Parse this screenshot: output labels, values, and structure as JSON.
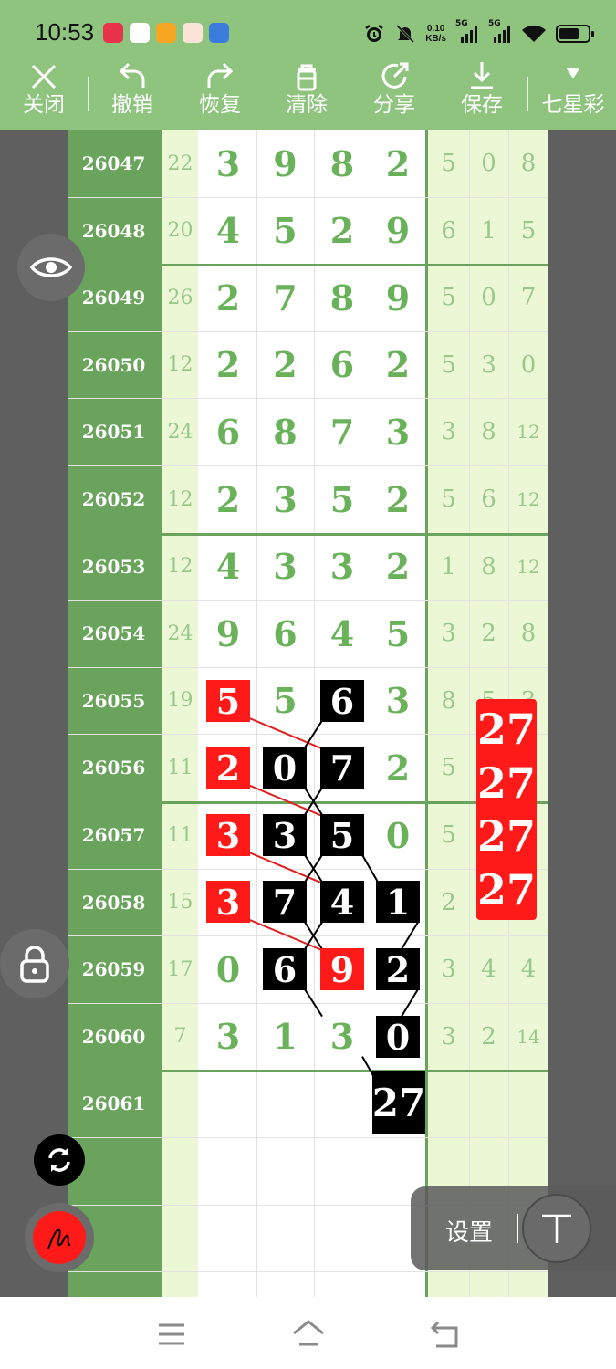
{
  "status_bar": {
    "time": "10:53",
    "net_speed_value": "0.10",
    "net_speed_unit": "KB/s",
    "signal_1": "5G",
    "signal_2": "5G",
    "icons": [
      "alarm-icon",
      "mute-icon",
      "signal-icon",
      "signal-icon",
      "wifi-icon",
      "battery-icon"
    ]
  },
  "toolbar": {
    "close": "关闭",
    "undo": "撤销",
    "redo": "恢复",
    "clear": "清除",
    "share": "分享",
    "save": "保存",
    "lottery": "七星彩"
  },
  "table": {
    "rows": [
      {
        "period": "26047",
        "sum": "22",
        "digits": [
          "3",
          "9",
          "8",
          "2"
        ],
        "extra": [
          "5",
          "0",
          "8"
        ]
      },
      {
        "period": "26048",
        "sum": "20",
        "digits": [
          "4",
          "5",
          "2",
          "9"
        ],
        "extra": [
          "6",
          "1",
          "5"
        ]
      },
      {
        "period": "26049",
        "sum": "26",
        "digits": [
          "2",
          "7",
          "8",
          "9"
        ],
        "extra": [
          "5",
          "0",
          "7"
        ]
      },
      {
        "period": "26050",
        "sum": "12",
        "digits": [
          "2",
          "2",
          "6",
          "2"
        ],
        "extra": [
          "5",
          "3",
          "0"
        ]
      },
      {
        "period": "26051",
        "sum": "24",
        "digits": [
          "6",
          "8",
          "7",
          "3"
        ],
        "extra": [
          "3",
          "8",
          "12"
        ]
      },
      {
        "period": "26052",
        "sum": "12",
        "digits": [
          "2",
          "3",
          "5",
          "2"
        ],
        "extra": [
          "5",
          "6",
          "12"
        ]
      },
      {
        "period": "26053",
        "sum": "12",
        "digits": [
          "4",
          "3",
          "3",
          "2"
        ],
        "extra": [
          "1",
          "8",
          "12"
        ]
      },
      {
        "period": "26054",
        "sum": "24",
        "digits": [
          "9",
          "6",
          "4",
          "5"
        ],
        "extra": [
          "3",
          "2",
          "8"
        ]
      },
      {
        "period": "26055",
        "sum": "19",
        "digits": [
          "5",
          "5",
          "6",
          "3"
        ],
        "extra": [
          "8",
          "5",
          "3"
        ]
      },
      {
        "period": "26056",
        "sum": "11",
        "digits": [
          "2",
          "0",
          "7",
          "2"
        ],
        "extra": [
          "5",
          "",
          ""
        ]
      },
      {
        "period": "26057",
        "sum": "11",
        "digits": [
          "3",
          "3",
          "5",
          "0"
        ],
        "extra": [
          "5",
          "",
          ""
        ]
      },
      {
        "period": "26058",
        "sum": "15",
        "digits": [
          "3",
          "7",
          "4",
          "1"
        ],
        "extra": [
          "2",
          "",
          ""
        ]
      },
      {
        "period": "26059",
        "sum": "17",
        "digits": [
          "0",
          "6",
          "9",
          "2"
        ],
        "extra": [
          "3",
          "4",
          "4"
        ]
      },
      {
        "period": "26060",
        "sum": "7",
        "digits": [
          "3",
          "1",
          "3",
          "0"
        ],
        "extra": [
          "3",
          "2",
          "14"
        ]
      },
      {
        "period": "26061",
        "sum": "",
        "digits": [
          "",
          "",
          "",
          ""
        ],
        "extra": [
          "",
          "",
          ""
        ]
      }
    ],
    "marks": [
      {
        "row": 8,
        "col": 0,
        "color": "red",
        "text": "5"
      },
      {
        "row": 8,
        "col": 2,
        "color": "black",
        "text": "6"
      },
      {
        "row": 9,
        "col": 0,
        "color": "red",
        "text": "2"
      },
      {
        "row": 9,
        "col": 1,
        "color": "black",
        "text": "0"
      },
      {
        "row": 9,
        "col": 2,
        "color": "black",
        "text": "7"
      },
      {
        "row": 10,
        "col": 0,
        "color": "red",
        "text": "3"
      },
      {
        "row": 10,
        "col": 1,
        "color": "black",
        "text": "3"
      },
      {
        "row": 10,
        "col": 2,
        "color": "black",
        "text": "5"
      },
      {
        "row": 11,
        "col": 0,
        "color": "red",
        "text": "3"
      },
      {
        "row": 11,
        "col": 1,
        "color": "black",
        "text": "7"
      },
      {
        "row": 11,
        "col": 2,
        "color": "black",
        "text": "4"
      },
      {
        "row": 11,
        "col": 3,
        "color": "black",
        "text": "1"
      },
      {
        "row": 12,
        "col": 1,
        "color": "black",
        "text": "6"
      },
      {
        "row": 12,
        "col": 2,
        "color": "red",
        "text": "9"
      },
      {
        "row": 12,
        "col": 3,
        "color": "black",
        "text": "2"
      },
      {
        "row": 13,
        "col": 3,
        "color": "black",
        "text": "0"
      }
    ],
    "total_box": "27",
    "red_stack": [
      "27",
      "27",
      "27",
      "27"
    ]
  },
  "floating": {
    "settings_label": "设置",
    "icons": [
      "eye-icon",
      "lock-icon",
      "refresh-icon",
      "pen-icon",
      "text-tool-icon"
    ]
  },
  "colors": {
    "toolbar_green": "#8fc47f",
    "index_green": "#6aa35c",
    "digit_green": "#6ab25a",
    "light_green": "#ecf7d6",
    "mark_red": "#ff1a1a"
  }
}
